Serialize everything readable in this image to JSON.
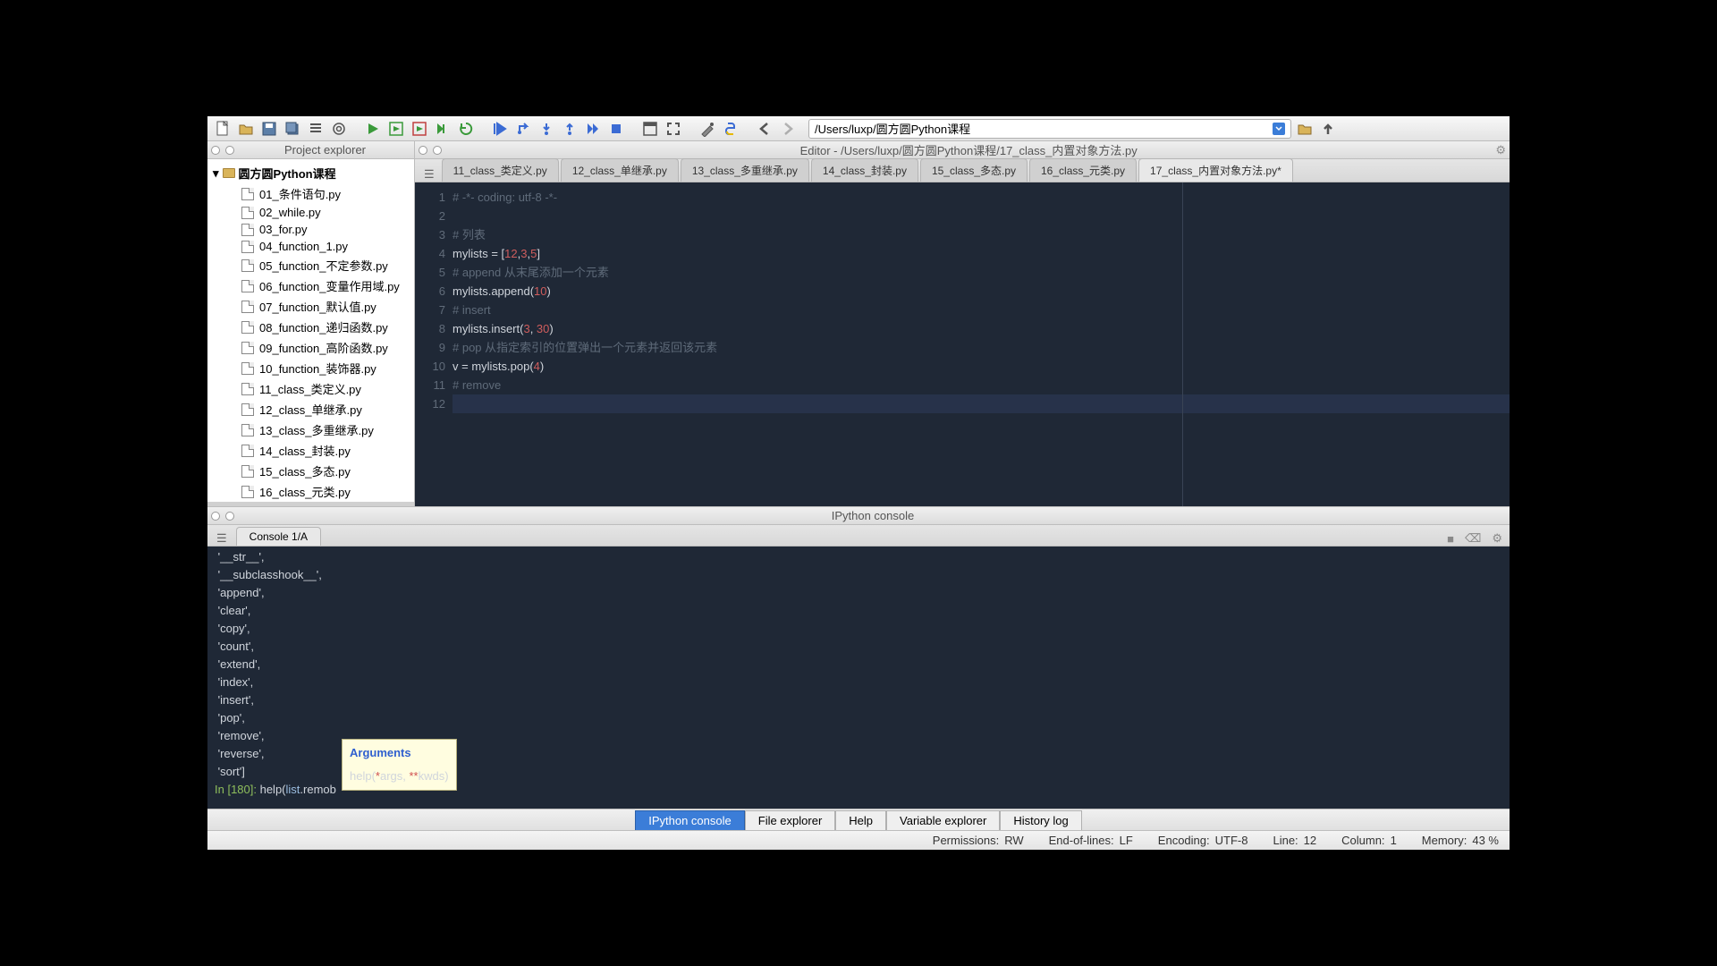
{
  "toolbar_path": "/Users/luxp/圆方圆Python课程",
  "panes": {
    "project_explorer": "Project explorer",
    "editor": "Editor - /Users/luxp/圆方圆Python课程/17_class_内置对象方法.py",
    "console": "IPython console"
  },
  "project_tree": {
    "root": "圆方圆Python课程",
    "files": [
      "01_条件语句.py",
      "02_while.py",
      "03_for.py",
      "04_function_1.py",
      "05_function_不定参数.py",
      "06_function_变量作用域.py",
      "07_function_默认值.py",
      "08_function_递归函数.py",
      "09_function_高阶函数.py",
      "10_function_装饰器.py",
      "11_class_类定义.py",
      "12_class_单继承.py",
      "13_class_多重继承.py",
      "14_class_封装.py",
      "15_class_多态.py",
      "16_class_元类.py",
      "17_class_内置对象方法.py"
    ],
    "selected_index": 16
  },
  "editor_tabs": [
    "11_class_类定义.py",
    "12_class_单继承.py",
    "13_class_多重继承.py",
    "14_class_封装.py",
    "15_class_多态.py",
    "16_class_元类.py",
    "17_class_内置对象方法.py*"
  ],
  "editor_active_tab": 6,
  "code": {
    "lines": [
      {
        "n": 1,
        "html": "<span class='cm'># -*- coding: utf-8 -*-</span>"
      },
      {
        "n": 2,
        "html": ""
      },
      {
        "n": 3,
        "html": "<span class='cm'># 列表</span>"
      },
      {
        "n": 4,
        "html": "mylists = [<span class='num'>12</span>,<span class='num'>3</span>,<span class='num'>5</span>]"
      },
      {
        "n": 5,
        "html": "<span class='cm'># append 从末尾添加一个元素</span>"
      },
      {
        "n": 6,
        "html": "mylists.append(<span class='num'>10</span>)"
      },
      {
        "n": 7,
        "html": "<span class='cm'># insert</span>"
      },
      {
        "n": 8,
        "html": "mylists.insert(<span class='num'>3</span>, <span class='num'>30</span>)"
      },
      {
        "n": 9,
        "html": "<span class='cm'># pop 从指定索引的位置弹出一个元素并返回该元素</span>"
      },
      {
        "n": 10,
        "html": "v = mylists.pop(<span class='num'>4</span>)"
      },
      {
        "n": 11,
        "html": "<span class='cm'># remove</span>"
      },
      {
        "n": 12,
        "html": "",
        "current": true
      }
    ]
  },
  "console_tab": "Console 1/A",
  "console_output": [
    " '__str__',",
    " '__subclasshook__',",
    " 'append',",
    " 'clear',",
    " 'copy',",
    " 'count',",
    " 'extend',",
    " 'index',",
    " 'insert',",
    " 'pop',",
    " 'remove',",
    " 'reverse',",
    " 'sort']"
  ],
  "console_prompt": {
    "label": "In [180]: ",
    "input_prefix": "help(",
    "input_builtin": "list",
    "input_suffix": ".remob"
  },
  "tooltip": {
    "title": "Arguments",
    "sig_prefix": "help(",
    "sig_args": "*args, **kwds",
    "sig_suffix": ")"
  },
  "bottom_tabs": [
    "IPython console",
    "File explorer",
    "Help",
    "Variable explorer",
    "History log"
  ],
  "bottom_active": 0,
  "status": {
    "permissions_label": "Permissions:",
    "permissions": "RW",
    "eol_label": "End-of-lines:",
    "eol": "LF",
    "encoding_label": "Encoding:",
    "encoding": "UTF-8",
    "line_label": "Line:",
    "line": "12",
    "col_label": "Column:",
    "col": "1",
    "mem_label": "Memory:",
    "mem": "43 %"
  }
}
